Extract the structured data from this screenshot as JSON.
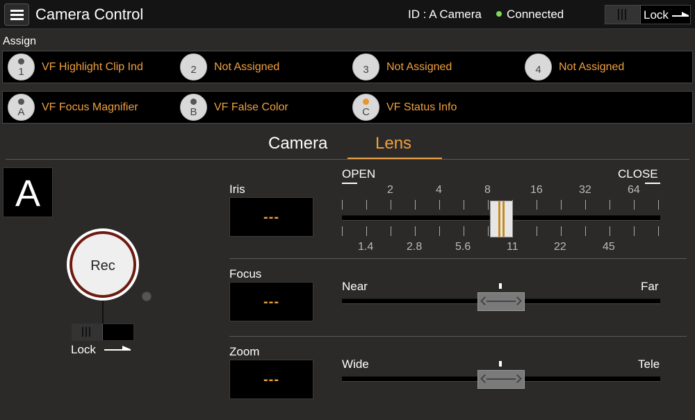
{
  "header": {
    "title": "Camera Control",
    "camera_id": "ID : A Camera",
    "status": "Connected",
    "status_color": "#7ed957",
    "lock_label": "Lock",
    "lock_state": "unlocked"
  },
  "assign": {
    "label": "Assign",
    "row1": [
      {
        "key": "1",
        "name": "VF Highlight Clip Ind",
        "led_on": false
      },
      {
        "key": "2",
        "name": "Not Assigned",
        "led_on": false
      },
      {
        "key": "3",
        "name": "Not Assigned",
        "led_on": false
      },
      {
        "key": "4",
        "name": "Not Assigned",
        "led_on": false
      }
    ],
    "row2": [
      {
        "key": "A",
        "name": "VF Focus Magnifier",
        "led_on": false
      },
      {
        "key": "B",
        "name": "VF False Color",
        "led_on": false
      },
      {
        "key": "C",
        "name": "VF Status Info",
        "led_on": true
      }
    ]
  },
  "tabs": [
    {
      "label": "Camera",
      "active": false
    },
    {
      "label": "Lens",
      "active": true
    }
  ],
  "left_panel": {
    "camera_letter": "A",
    "rec_label": "Rec",
    "lock_label": "Lock"
  },
  "iris": {
    "label": "Iris",
    "value": "---",
    "open_label": "OPEN",
    "close_label": "CLOSE",
    "top_scale": [
      "2",
      "4",
      "8",
      "16",
      "32",
      "64"
    ],
    "bottom_scale": [
      "1.4",
      "2.8",
      "5.6",
      "11",
      "22",
      "45"
    ]
  },
  "focus": {
    "label": "Focus",
    "value": "---",
    "min_label": "Near",
    "max_label": "Far",
    "position": 0.5
  },
  "zoom": {
    "label": "Zoom",
    "value": "---",
    "min_label": "Wide",
    "max_label": "Tele",
    "position": 0.5
  },
  "colors": {
    "accent": "#f0a040",
    "rec_ring": "#6e1a10"
  }
}
